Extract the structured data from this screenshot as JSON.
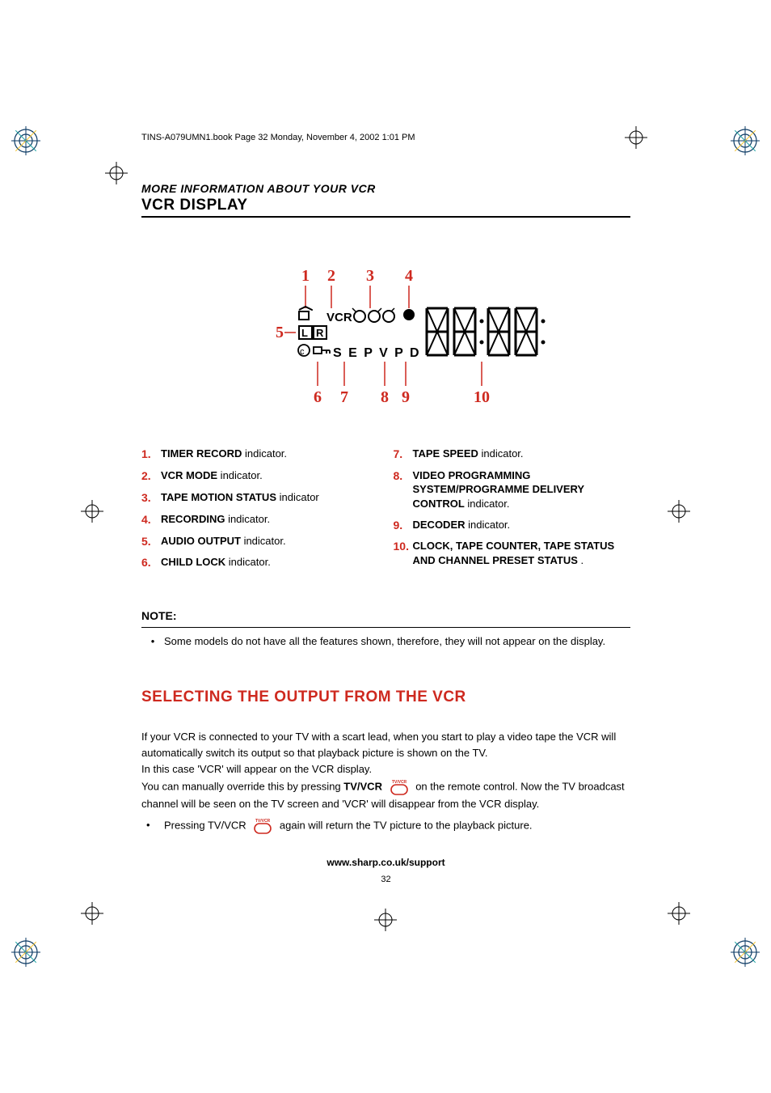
{
  "book_header": "TINS-A079UMN1.book  Page 32  Monday, November 4, 2002  1:01 PM",
  "section_header": "MORE INFORMATION ABOUT YOUR VCR",
  "section_title": "VCR DISPLAY",
  "diagram": {
    "callouts_top": [
      "1",
      "2",
      "3",
      "4"
    ],
    "callout_left": "5",
    "callouts_bottom": [
      "6",
      "7",
      "8",
      "9",
      "10"
    ],
    "lcd_text": {
      "vcr": "VCR",
      "L": "L",
      "R": "R",
      "bottom": "S E P V P D"
    }
  },
  "items_left": [
    {
      "n": "1.",
      "bold": "TIMER RECORD",
      "rest": " indicator."
    },
    {
      "n": "2.",
      "bold": "VCR  MODE",
      "rest": " indicator."
    },
    {
      "n": "3.",
      "bold": "TAPE MOTION STATUS",
      "rest": " indicator"
    },
    {
      "n": "4.",
      "bold": "RECORDING",
      "rest": " indicator."
    },
    {
      "n": "5.",
      "bold": "AUDIO OUTPUT",
      "rest": " indicator."
    },
    {
      "n": "6.",
      "bold": "CHILD LOCK",
      "rest": " indicator."
    }
  ],
  "items_right": [
    {
      "n": "7.",
      "bold": "TAPE SPEED",
      "rest": " indicator."
    },
    {
      "n": "8.",
      "bold": "VIDEO PROGRAMMING SYSTEM/PROGRAMME DELIVERY CONTROL",
      "rest": " indicator."
    },
    {
      "n": "9.",
      "bold": "DECODER",
      "rest": " indicator."
    },
    {
      "n": "10.",
      "bold": "CLOCK, TAPE COUNTER, TAPE STATUS AND CHANNEL PRESET STATUS",
      "rest": " ."
    }
  ],
  "note_head": "NOTE:",
  "note_body": "Some models do not have all the features shown, therefore, they will not appear on the display.",
  "h2": "SELECTING THE OUTPUT FROM THE VCR",
  "para": {
    "p1": "If your VCR is connected to your TV with a scart lead, when you start to play a video tape the VCR will automatically switch its output so that playback picture is shown on the TV.",
    "p2": "In this case 'VCR' will appear on the VCR display.",
    "p3a": "You can manually override this by pressing ",
    "p3b": "TV/VCR",
    "p3c": " on the remote control. Now the TV broadcast channel will be seen on the TV screen and 'VCR' will disappear from the VCR display.",
    "p4a": "Pressing ",
    "p4b": "TV/VCR",
    "p4c": " again will return the TV picture to the playback picture.",
    "btn_label": "TV/VCR"
  },
  "footer_url": "www.sharp.co.uk/support",
  "footer_pg": "32"
}
